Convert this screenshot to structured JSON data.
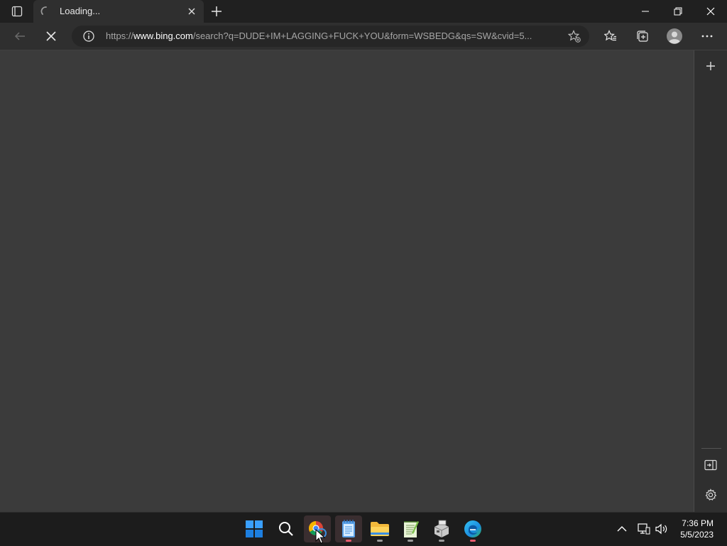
{
  "browser": {
    "tab": {
      "title": "Loading..."
    },
    "address_bar": {
      "url_prefix": "https://",
      "url_domain": "www.bing.com",
      "url_rest": "/search?q=DUDE+IM+LAGGING+FUCK+YOU&form=WSBEDG&qs=SW&cvid=5..."
    }
  },
  "taskbar": {
    "apps": [
      "start-icon",
      "search-icon",
      "chrome-icon",
      "notepad-icon",
      "file-explorer-icon",
      "notepadpp-icon",
      "installer-icon",
      "edge-icon"
    ],
    "clock": {
      "time": "7:36 PM",
      "date": "5/5/2023"
    }
  },
  "colors": {
    "accent_red": "#e85b6e",
    "taskbar_bg": "#1c1c1c",
    "content_bg": "#3b3b3b"
  }
}
